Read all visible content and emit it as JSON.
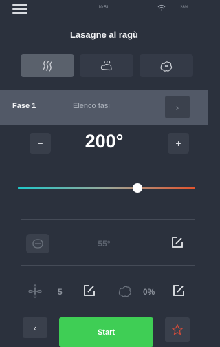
{
  "status": {
    "time": "10:51",
    "battery": "28%"
  },
  "title": "Lasagne al ragù",
  "modes": [
    {
      "name": "convection",
      "icon": "heat-waves-icon",
      "active": true
    },
    {
      "name": "steam",
      "icon": "steam-icon",
      "active": false
    },
    {
      "name": "combi",
      "icon": "combi-cloud-icon",
      "active": false
    }
  ],
  "phase": {
    "current_label": "Fase 1",
    "list_label": "Elenco fasi"
  },
  "temperature": {
    "value": "200°",
    "minus_label": "−",
    "plus_label": "+",
    "slider_fraction": 0.68
  },
  "probe": {
    "value": "55°"
  },
  "fan": {
    "speed": "5"
  },
  "humidity": {
    "value": "0%"
  },
  "actions": {
    "start_label": "Start"
  },
  "colors": {
    "background": "#2b313d",
    "accent_green": "#3fce55",
    "slider_cold": "#1fc7c9",
    "slider_hot": "#e3542d",
    "favorite": "#c94b3b"
  }
}
